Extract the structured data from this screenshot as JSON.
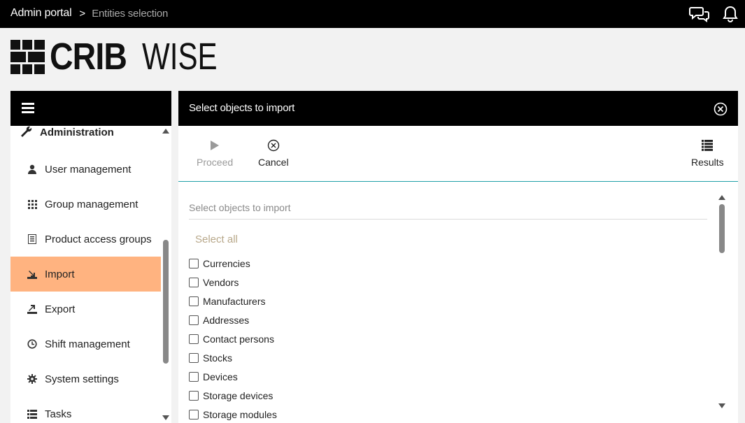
{
  "breadcrumb": {
    "root": "Admin portal",
    "separator": ">",
    "current": "Entities selection"
  },
  "topbar": {
    "icons": [
      "chat-icon",
      "bell-icon"
    ]
  },
  "logo": {
    "bold": "CRIB",
    "light": "WISE"
  },
  "sidebar": {
    "section": "Administration",
    "items": [
      {
        "label": "User management",
        "icon": "user-icon"
      },
      {
        "label": "Group management",
        "icon": "grid-icon"
      },
      {
        "label": "Product access groups",
        "icon": "list-doc-icon"
      },
      {
        "label": "Import",
        "icon": "import-icon",
        "active": true
      },
      {
        "label": "Export",
        "icon": "export-icon"
      },
      {
        "label": "Shift management",
        "icon": "clock-icon"
      },
      {
        "label": "System settings",
        "icon": "gear-icon"
      },
      {
        "label": "Tasks",
        "icon": "tasks-icon"
      }
    ]
  },
  "panel": {
    "title": "Select objects to import",
    "toolbar": {
      "proceed": "Proceed",
      "cancel": "Cancel",
      "results": "Results"
    },
    "field_placeholder": "Select objects to import",
    "select_all": "Select all",
    "options": [
      "Currencies",
      "Vendors",
      "Manufacturers",
      "Addresses",
      "Contact persons",
      "Stocks",
      "Devices",
      "Storage devices",
      "Storage modules"
    ]
  },
  "colors": {
    "topbar": "#000000",
    "active_item": "#ffb380",
    "accent_line": "#20a0a8",
    "select_all": "#b8a88a"
  }
}
